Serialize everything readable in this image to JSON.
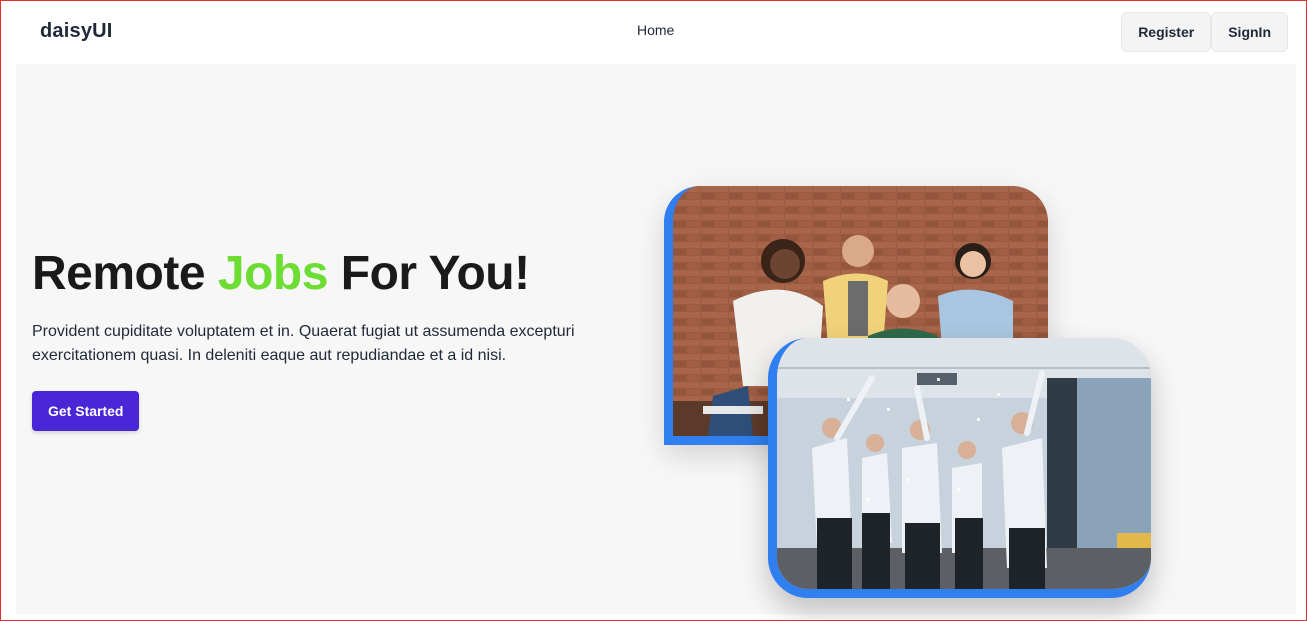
{
  "navbar": {
    "brand": "daisyUI",
    "links": [
      "Home"
    ],
    "register_label": "Register",
    "signin_label": "SignIn"
  },
  "hero": {
    "title_part1": "Remote ",
    "title_accent": "Jobs",
    "title_part2": " For You!",
    "description": "Provident cupiditate voluptatem et in. Quaerat fugiat ut assumenda excepturi exercitationem quasi. In deleniti eaque aut repudiandae et a id nisi.",
    "cta_label": "Get Started"
  },
  "colors": {
    "accent": "#6ddc33",
    "primary_button": "#4a27d6",
    "image_border": "#2f7ff0"
  }
}
